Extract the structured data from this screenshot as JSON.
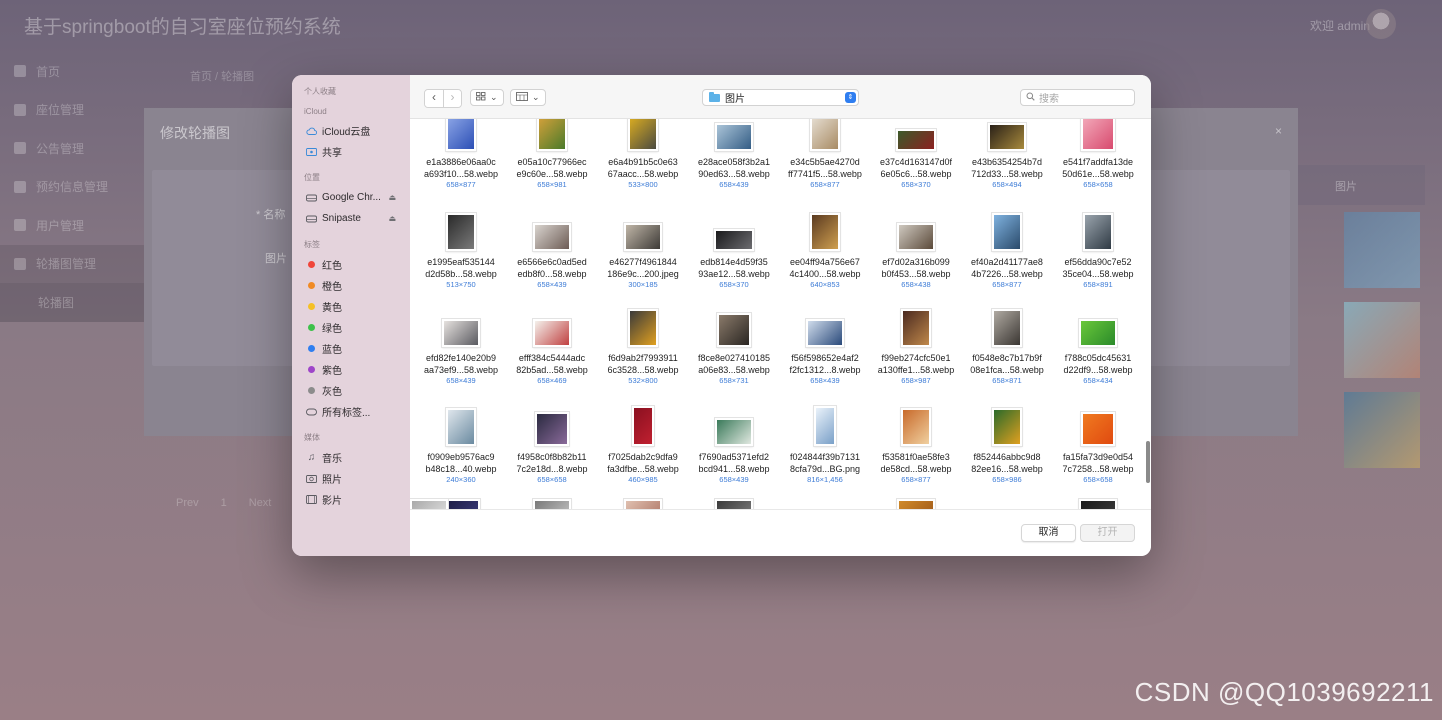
{
  "app": {
    "title": "基于springboot的自习室座位预约系统",
    "user": "欢迎 admin",
    "sidebar": [
      {
        "label": "首页"
      },
      {
        "label": "座位管理"
      },
      {
        "label": "公告管理"
      },
      {
        "label": "预约信息管理"
      },
      {
        "label": "用户管理"
      },
      {
        "label": "轮播图管理"
      },
      {
        "label": "轮播图"
      }
    ],
    "breadcrumb": "首页  /  轮播图",
    "table_header": "图片",
    "pager": {
      "prev": "Prev",
      "page": "1",
      "next": "Next"
    }
  },
  "edit_dialog": {
    "title": "修改轮播图",
    "close": "×",
    "name_label": "* 名称",
    "image_label": "图片"
  },
  "panel": {
    "sidebar": {
      "favorites_head": "个人收藏",
      "icloud_head": "iCloud",
      "icloud_items": [
        {
          "label": "iCloud云盘",
          "icon": "cloud-icon"
        },
        {
          "label": "共享",
          "icon": "shared-folder-icon"
        }
      ],
      "locations_head": "位置",
      "locations": [
        {
          "label": "Google Chr...",
          "icon": "disk-icon"
        },
        {
          "label": "Snipaste",
          "icon": "disk-icon"
        }
      ],
      "tags_head": "标签",
      "tags": [
        {
          "label": "红色",
          "color": "#f0453a"
        },
        {
          "label": "橙色",
          "color": "#f08a24"
        },
        {
          "label": "黄色",
          "color": "#f5c026"
        },
        {
          "label": "绿色",
          "color": "#3dc14a"
        },
        {
          "label": "蓝色",
          "color": "#2f7ef0"
        },
        {
          "label": "紫色",
          "color": "#9e45c9"
        },
        {
          "label": "灰色",
          "color": "#8c8c8c"
        }
      ],
      "all_tags": "所有标签...",
      "media_head": "媒体",
      "media": [
        {
          "label": "音乐",
          "icon": "music-icon"
        },
        {
          "label": "照片",
          "icon": "photos-icon"
        },
        {
          "label": "影片",
          "icon": "movies-icon"
        }
      ]
    },
    "toolbar": {
      "back": "‹",
      "forward": "›",
      "location": "图片",
      "search_placeholder": "搜索"
    },
    "files": [
      {
        "name": [
          "e1a3886e06aa0c",
          "a693f10...58.webp"
        ],
        "size": "658×877",
        "colors": [
          "#8fa8e8",
          "#2c4fb5"
        ],
        "shape": "p"
      },
      {
        "name": [
          "e05a10c77966ec",
          "e9c60e...58.webp"
        ],
        "size": "658×981",
        "colors": [
          "#d9a23b",
          "#4a7a2a"
        ],
        "shape": "p"
      },
      {
        "name": [
          "e6a4b91b5c0e63",
          "67aacc...58.webp"
        ],
        "size": "533×800",
        "colors": [
          "#e0b020",
          "#4b4b40"
        ],
        "shape": "p"
      },
      {
        "name": [
          "e28ace058f3b2a1",
          "90ed63...58.webp"
        ],
        "size": "658×439",
        "colors": [
          "#aac4d8",
          "#345d85"
        ],
        "shape": "l"
      },
      {
        "name": [
          "e34c5b5ae4270d",
          "ff7741f5...58.webp"
        ],
        "size": "658×877",
        "colors": [
          "#e8e1d6",
          "#a88b64"
        ],
        "shape": "p"
      },
      {
        "name": [
          "e37c4d163147d0f",
          "6e05c6...58.webp"
        ],
        "size": "658×370",
        "colors": [
          "#3c5a2a",
          "#8c2020"
        ],
        "shape": "w"
      },
      {
        "name": [
          "e43b6354254b7d",
          "712d33...58.webp"
        ],
        "size": "658×494",
        "colors": [
          "#2a2118",
          "#a88a3c"
        ],
        "shape": "l"
      },
      {
        "name": [
          "e541f7addfa13de",
          "50d61e...58.webp"
        ],
        "size": "658×658",
        "colors": [
          "#f2a7b8",
          "#d84a6e"
        ],
        "shape": "s"
      },
      {
        "name": [
          "e1995eaf535144",
          "d2d58b...58.webp"
        ],
        "size": "513×750",
        "colors": [
          "#2a2a2a",
          "#7a7a7a"
        ],
        "shape": "p"
      },
      {
        "name": [
          "e6566e6c0ad5ed",
          "edb8f0...58.webp"
        ],
        "size": "658×439",
        "colors": [
          "#d9d4cf",
          "#6d5c55"
        ],
        "shape": "l"
      },
      {
        "name": [
          "e46277f4961844",
          "186e9c...200.jpeg"
        ],
        "size": "300×185",
        "colors": [
          "#c0b6a8",
          "#3d3a36"
        ],
        "shape": "l"
      },
      {
        "name": [
          "edb814e4d59f35",
          "93ae12...58.webp"
        ],
        "size": "658×370",
        "colors": [
          "#1a1a1c",
          "#6c6c70"
        ],
        "shape": "w"
      },
      {
        "name": [
          "ee04ff94a756e67",
          "4c1400...58.webp"
        ],
        "size": "640×853",
        "colors": [
          "#5a3a20",
          "#d0a050"
        ],
        "shape": "p"
      },
      {
        "name": [
          "ef7d02a316b099",
          "b0f453...58.webp"
        ],
        "size": "658×438",
        "colors": [
          "#cfc9c0",
          "#5b4a3a"
        ],
        "shape": "l"
      },
      {
        "name": [
          "ef40a2d41177ae8",
          "4b7226...58.webp"
        ],
        "size": "658×877",
        "colors": [
          "#7fb2e0",
          "#2a4a6a"
        ],
        "shape": "p"
      },
      {
        "name": [
          "ef56dda90c7e52",
          "35ce04...58.webp"
        ],
        "size": "658×891",
        "colors": [
          "#9aa4ad",
          "#2f3a44"
        ],
        "shape": "p"
      },
      {
        "name": [
          "efd82fe140e20b9",
          "aa73ef9...58.webp"
        ],
        "size": "658×439",
        "colors": [
          "#e6e2df",
          "#5a5a60"
        ],
        "shape": "l"
      },
      {
        "name": [
          "efff384c5444adc",
          "82b5ad...58.webp"
        ],
        "size": "658×469",
        "colors": [
          "#f4f1ec",
          "#c04040"
        ],
        "shape": "l"
      },
      {
        "name": [
          "f6d9ab2f7993911",
          "6c3528...58.webp"
        ],
        "size": "532×800",
        "colors": [
          "#3a3a3a",
          "#e0a020"
        ],
        "shape": "p"
      },
      {
        "name": [
          "f8ce8e027410185",
          "a06e83...58.webp"
        ],
        "size": "658×731",
        "colors": [
          "#8a7a6a",
          "#2a2622"
        ],
        "shape": "s"
      },
      {
        "name": [
          "f56f598652e4af2",
          "f2fc1312...8.webp"
        ],
        "size": "658×439",
        "colors": [
          "#d0dcec",
          "#2a4a7a"
        ],
        "shape": "l"
      },
      {
        "name": [
          "f99eb274cfc50e1",
          "a130ffe1...58.webp"
        ],
        "size": "658×987",
        "colors": [
          "#4a2a20",
          "#c0884a"
        ],
        "shape": "p"
      },
      {
        "name": [
          "f0548e8c7b17b9f",
          "08e1fca...58.webp"
        ],
        "size": "658×871",
        "colors": [
          "#b0aaa2",
          "#3a3632"
        ],
        "shape": "p"
      },
      {
        "name": [
          "f788c05dc45631",
          "d22df9...58.webp"
        ],
        "size": "658×434",
        "colors": [
          "#6ac83a",
          "#2a8a2a"
        ],
        "shape": "l"
      },
      {
        "name": [
          "f0909eb9576ac9",
          "b48c18...40.webp"
        ],
        "size": "240×360",
        "colors": [
          "#dfe6ec",
          "#6a8aa0"
        ],
        "shape": "p"
      },
      {
        "name": [
          "f4958c0f8b82b11",
          "7c2e18d...8.webp"
        ],
        "size": "658×658",
        "colors": [
          "#2a2a40",
          "#8a6a9a"
        ],
        "shape": "s"
      },
      {
        "name": [
          "f7025dab2c9dfa9",
          "fa3dfbe...58.webp"
        ],
        "size": "460×985",
        "colors": [
          "#8a1020",
          "#c02030"
        ],
        "shape": "t"
      },
      {
        "name": [
          "f7690ad5371efd2",
          "bcd941...58.webp"
        ],
        "size": "658×439",
        "colors": [
          "#3a7a5a",
          "#e0e8e0"
        ],
        "shape": "l"
      },
      {
        "name": [
          "f024844f39b7131",
          "8cfa79d...BG.png"
        ],
        "size": "816×1,456",
        "colors": [
          "#eaf2fa",
          "#7aa0c8"
        ],
        "shape": "t"
      },
      {
        "name": [
          "f53581f0ae58fe3",
          "de58cd...58.webp"
        ],
        "size": "658×877",
        "colors": [
          "#c86a2a",
          "#f0d0a0"
        ],
        "shape": "p"
      },
      {
        "name": [
          "f852446abbc9d8",
          "82ee16...58.webp"
        ],
        "size": "658×986",
        "colors": [
          "#2a6a2a",
          "#e0a020"
        ],
        "shape": "p"
      },
      {
        "name": [
          "fa15fa73d9e0d54",
          "7c7258...58.webp"
        ],
        "size": "658×658",
        "colors": [
          "#f07a20",
          "#e04a10"
        ],
        "shape": "s"
      }
    ],
    "partial_row": [
      {
        "colors": [
          "#1a1a40",
          "#3a3a7a"
        ]
      },
      {
        "colors": [
          "#7a7a7a",
          "#bfbfbf"
        ]
      },
      {
        "colors": [
          "#e0c0b0",
          "#b07a6a"
        ]
      },
      {
        "colors": [
          "#3a3a3a",
          "#7a7a7a"
        ]
      },
      null,
      {
        "colors": [
          "#d08a2a",
          "#a05a1a"
        ]
      },
      null,
      {
        "colors": [
          "#1a1a1a",
          "#3a3a3a"
        ]
      },
      {
        "colors": [
          "#aaaaaa",
          "#dddddd"
        ]
      }
    ],
    "buttons": {
      "cancel": "取消",
      "open": "打开"
    }
  },
  "watermark": "CSDN @QQ1039692211"
}
